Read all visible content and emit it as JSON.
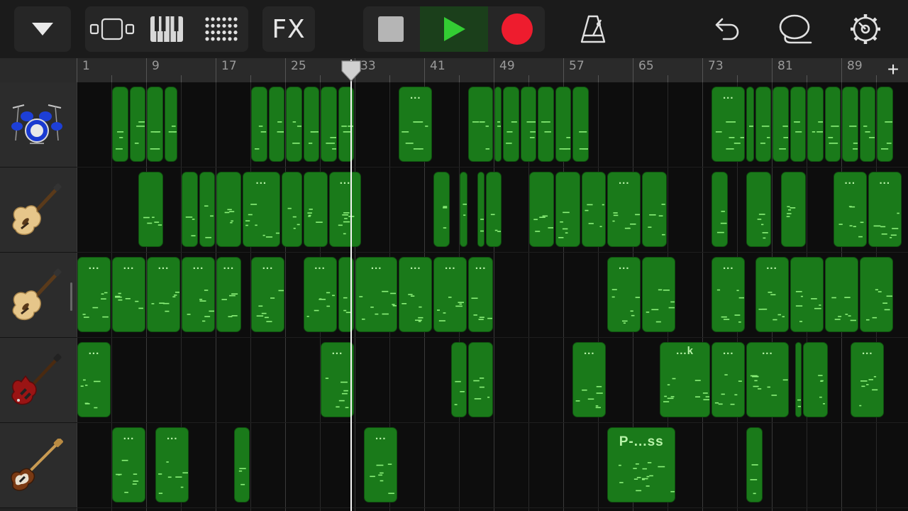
{
  "toolbar": {
    "buttons": [
      {
        "name": "menu-dropdown-button",
        "icon": "triangle-down-icon"
      },
      {
        "name": "tracks-view-button",
        "icon": "tracks-view-icon"
      },
      {
        "name": "keyboard-button",
        "icon": "piano-keys-icon"
      },
      {
        "name": "live-loops-button",
        "icon": "grid-dots-icon"
      },
      {
        "name": "fx-button",
        "label": "FX"
      },
      {
        "name": "stop-button",
        "icon": "stop-square-icon"
      },
      {
        "name": "play-button",
        "icon": "play-triangle-icon"
      },
      {
        "name": "record-button",
        "icon": "record-circle-icon"
      },
      {
        "name": "metronome-button",
        "icon": "metronome-icon"
      },
      {
        "name": "undo-button",
        "icon": "undo-arrow-icon"
      },
      {
        "name": "loop-browser-button",
        "icon": "lasso-loop-icon"
      },
      {
        "name": "settings-button",
        "icon": "gear-icon"
      }
    ],
    "colors": {
      "play": "#33cc33",
      "record": "#ee1c2e",
      "stop": "#b5b5b5"
    }
  },
  "ruler": {
    "bar_numbers": [
      "1",
      "9",
      "17",
      "25",
      "33",
      "41",
      "49",
      "57",
      "65",
      "73",
      "81",
      "89"
    ],
    "add_label": "+"
  },
  "playhead": {
    "bar": 32.5
  },
  "tracks": [
    {
      "instrument": "drums",
      "icon": "drum-kit-icon"
    },
    {
      "instrument": "acoustic-guitar",
      "icon": "acoustic-guitar-icon"
    },
    {
      "instrument": "acoustic-guitar-2",
      "icon": "acoustic-guitar-icon"
    },
    {
      "instrument": "electric-guitar",
      "icon": "electric-guitar-icon"
    },
    {
      "instrument": "bass",
      "icon": "bass-guitar-icon"
    }
  ],
  "regions": [
    [
      {
        "start": 5,
        "len": 2
      },
      {
        "start": 7,
        "len": 2
      },
      {
        "start": 9,
        "len": 2
      },
      {
        "start": 11,
        "len": 1.7
      },
      {
        "start": 21,
        "len": 2
      },
      {
        "start": 23,
        "len": 2
      },
      {
        "start": 25,
        "len": 2
      },
      {
        "start": 27,
        "len": 2
      },
      {
        "start": 29,
        "len": 2
      },
      {
        "start": 31,
        "len": 2
      },
      {
        "start": 38,
        "len": 4,
        "label": "..."
      },
      {
        "start": 46,
        "len": 3
      },
      {
        "start": 49,
        "len": 1
      },
      {
        "start": 50,
        "len": 2
      },
      {
        "start": 52,
        "len": 2
      },
      {
        "start": 54,
        "len": 2
      },
      {
        "start": 56,
        "len": 2
      },
      {
        "start": 58,
        "len": 2
      },
      {
        "start": 74,
        "len": 4,
        "label": "..."
      },
      {
        "start": 78,
        "len": 1
      },
      {
        "start": 79,
        "len": 2
      },
      {
        "start": 81,
        "len": 2
      },
      {
        "start": 83,
        "len": 2
      },
      {
        "start": 85,
        "len": 2
      },
      {
        "start": 87,
        "len": 2
      },
      {
        "start": 89,
        "len": 2
      },
      {
        "start": 91,
        "len": 2
      },
      {
        "start": 93,
        "len": 2
      }
    ],
    [
      {
        "start": 8,
        "len": 3
      },
      {
        "start": 13,
        "len": 2
      },
      {
        "start": 15,
        "len": 2
      },
      {
        "start": 17,
        "len": 3
      },
      {
        "start": 20,
        "len": 4.5,
        "label": "..."
      },
      {
        "start": 24.5,
        "len": 2.5
      },
      {
        "start": 27,
        "len": 3
      },
      {
        "start": 30,
        "len": 3.8,
        "label": "..."
      },
      {
        "start": 42,
        "len": 2
      },
      {
        "start": 45,
        "len": 1.1
      },
      {
        "start": 47,
        "len": 1
      },
      {
        "start": 48,
        "len": 2
      },
      {
        "start": 53,
        "len": 3
      },
      {
        "start": 56,
        "len": 3
      },
      {
        "start": 59,
        "len": 3
      },
      {
        "start": 62,
        "len": 4,
        "label": "..."
      },
      {
        "start": 66,
        "len": 3
      },
      {
        "start": 74,
        "len": 2
      },
      {
        "start": 78,
        "len": 3
      },
      {
        "start": 82,
        "len": 3
      },
      {
        "start": 88,
        "len": 4,
        "label": "..."
      },
      {
        "start": 92,
        "len": 4,
        "label": "..."
      }
    ],
    [
      {
        "start": 1,
        "len": 4,
        "label": "..."
      },
      {
        "start": 5,
        "len": 4,
        "label": "..."
      },
      {
        "start": 9,
        "len": 4,
        "label": "..."
      },
      {
        "start": 13,
        "len": 4,
        "label": "..."
      },
      {
        "start": 17,
        "len": 3,
        "label": "..."
      },
      {
        "start": 21,
        "len": 4,
        "label": "..."
      },
      {
        "start": 27,
        "len": 4,
        "label": "..."
      },
      {
        "start": 31,
        "len": 2
      },
      {
        "start": 33,
        "len": 5,
        "label": "..."
      },
      {
        "start": 38,
        "len": 4,
        "label": "..."
      },
      {
        "start": 42,
        "len": 4,
        "label": "..."
      },
      {
        "start": 46,
        "len": 3,
        "label": "..."
      },
      {
        "start": 62,
        "len": 4,
        "label": "..."
      },
      {
        "start": 66,
        "len": 4
      },
      {
        "start": 74,
        "len": 4,
        "label": "..."
      },
      {
        "start": 79,
        "len": 4,
        "label": "..."
      },
      {
        "start": 83,
        "len": 4
      },
      {
        "start": 87,
        "len": 4
      },
      {
        "start": 91,
        "len": 4
      }
    ],
    [
      {
        "start": 1,
        "len": 4,
        "label": "..."
      },
      {
        "start": 29,
        "len": 4,
        "label": "..."
      },
      {
        "start": 44,
        "len": 2
      },
      {
        "start": 46,
        "len": 3
      },
      {
        "start": 58,
        "len": 4,
        "label": "..."
      },
      {
        "start": 68,
        "len": 6,
        "label": "...k"
      },
      {
        "start": 74,
        "len": 4,
        "label": "..."
      },
      {
        "start": 78,
        "len": 5,
        "label": "..."
      },
      {
        "start": 83.6,
        "len": 0.9
      },
      {
        "start": 84.5,
        "len": 3
      },
      {
        "start": 90,
        "len": 4,
        "label": "..."
      }
    ],
    [
      {
        "start": 5,
        "len": 4,
        "label": "..."
      },
      {
        "start": 10,
        "len": 4,
        "label": "..."
      },
      {
        "start": 19,
        "len": 2
      },
      {
        "start": 34,
        "len": 4,
        "label": "..."
      },
      {
        "start": 62,
        "len": 8,
        "label": "P-...ss",
        "big": true
      },
      {
        "start": 78,
        "len": 2
      }
    ]
  ]
}
